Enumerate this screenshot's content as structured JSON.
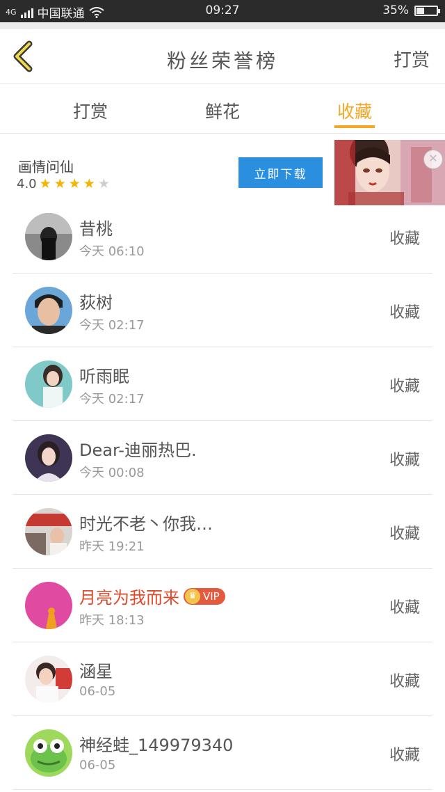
{
  "status_bar": {
    "network": "4G",
    "carrier": "中国联通",
    "time": "09:27",
    "battery": "35%",
    "battery_level": 0.35
  },
  "header": {
    "title": "粉丝荣誉榜",
    "right_label": "打赏"
  },
  "tabs": [
    {
      "label": "打赏",
      "active": false
    },
    {
      "label": "鲜花",
      "active": false
    },
    {
      "label": "收藏",
      "active": true
    }
  ],
  "ad": {
    "title": "画情问仙",
    "rating": "4.0",
    "stars": 4,
    "button_label": "立即下载"
  },
  "colors": {
    "accent": "#f5a623",
    "ad_button": "#2b8fe0",
    "vip_name": "#e04a2c"
  },
  "fans": [
    {
      "name": "昔桃",
      "time": "今天 06:10",
      "action": "收藏",
      "vip": false
    },
    {
      "name": "荻树",
      "time": "今天 02:17",
      "action": "收藏",
      "vip": false
    },
    {
      "name": "听雨眠",
      "time": "今天 02:17",
      "action": "收藏",
      "vip": false
    },
    {
      "name": "Dear-迪丽热巴.",
      "time": "今天 00:08",
      "action": "收藏",
      "vip": false
    },
    {
      "name": "时光不老丶你我…",
      "time": "昨天 19:21",
      "action": "收藏",
      "vip": false
    },
    {
      "name": "月亮为我而来",
      "time": "昨天 18:13",
      "action": "收藏",
      "vip": true,
      "vip_label": "VIP"
    },
    {
      "name": "涵星",
      "time": "06-05",
      "action": "收藏",
      "vip": false
    },
    {
      "name": "神经蛙_149979340",
      "time": "06-05",
      "action": "收藏",
      "vip": false
    }
  ]
}
